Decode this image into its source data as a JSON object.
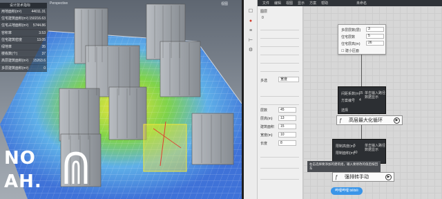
{
  "viewport": {
    "corner_left": "Perspective",
    "corner_right": "视图"
  },
  "stats": {
    "header": "设计技术指标",
    "rows": [
      {
        "label": "用地面积(m²)",
        "value": "44011.31"
      },
      {
        "label": "住宅建筑面积(m²)",
        "value": "150216.63"
      },
      {
        "label": "住宅占地面积(m²)",
        "value": "5744.86"
      },
      {
        "label": "容积率",
        "value": "3.53"
      },
      {
        "label": "住宅建筑密度",
        "value": "13.05"
      },
      {
        "label": "绿地率",
        "value": "35"
      },
      {
        "label": "楼栋数(个)",
        "value": "37"
      },
      {
        "label": "高层建筑面积(m²)",
        "value": "15263.6"
      },
      {
        "label": "多层建筑面积(m²)",
        "value": "0"
      }
    ]
  },
  "logo": {
    "line1": "NO",
    "line2": "AH."
  },
  "menubar": {
    "items": [
      "文件",
      "编辑",
      "视图",
      "显示",
      "方案",
      "帮助"
    ],
    "title": "未命名"
  },
  "toolbar_icons": [
    "select-icon",
    "record-icon",
    "layers-icon",
    "tree-icon",
    "settings-icon"
  ],
  "props": {
    "top_label": "图层",
    "sub_label": "0",
    "mode_label": "多选",
    "mode_value": "宽度",
    "fields": [
      {
        "label": "层数",
        "value": "45"
      },
      {
        "label": "层高(m)",
        "value": "13"
      },
      {
        "label": "建筑面积",
        "value": "15"
      },
      {
        "label": "宽度(m)",
        "value": "10"
      },
      {
        "label": "长度",
        "value": "8"
      }
    ]
  },
  "node_params": {
    "rows": [
      {
        "label": "多层层数(层)",
        "value": "3"
      },
      {
        "label": "住宅层数",
        "value": "5"
      },
      {
        "label": "住宅层高(m)",
        "value": "26"
      }
    ],
    "checkbox": "建小区面"
  },
  "dark_node_1": {
    "rows": [
      {
        "label": "间距系数(m)",
        "value": "25"
      },
      {
        "label": "方案编号",
        "value": "4"
      }
    ],
    "hint": "单击输入路径\n数据显示",
    "footer": "选择"
  },
  "comp_1": {
    "label": "高层最大化循环"
  },
  "dark_node_2": {
    "rows": [
      {
        "label": "限制高度(m)",
        "value": "5"
      },
      {
        "label": "限制面积(m)",
        "value": "40"
      }
    ],
    "hint": "单击输入路径\n数据显示"
  },
  "comp_2": {
    "label": "强排转手动"
  },
  "tooltip": {
    "text": "右击选择要添加的建筑组，输入要修改的值后按回车"
  },
  "bili": {
    "label": "哔哩哔哩 bilibili"
  },
  "colors": {
    "accent": "#3a95e8",
    "building": "#9aa0a6",
    "heat_green": "#3fbf3f",
    "heat_yellow": "#f0e63a",
    "heat_blue": "#5aa0e6"
  }
}
